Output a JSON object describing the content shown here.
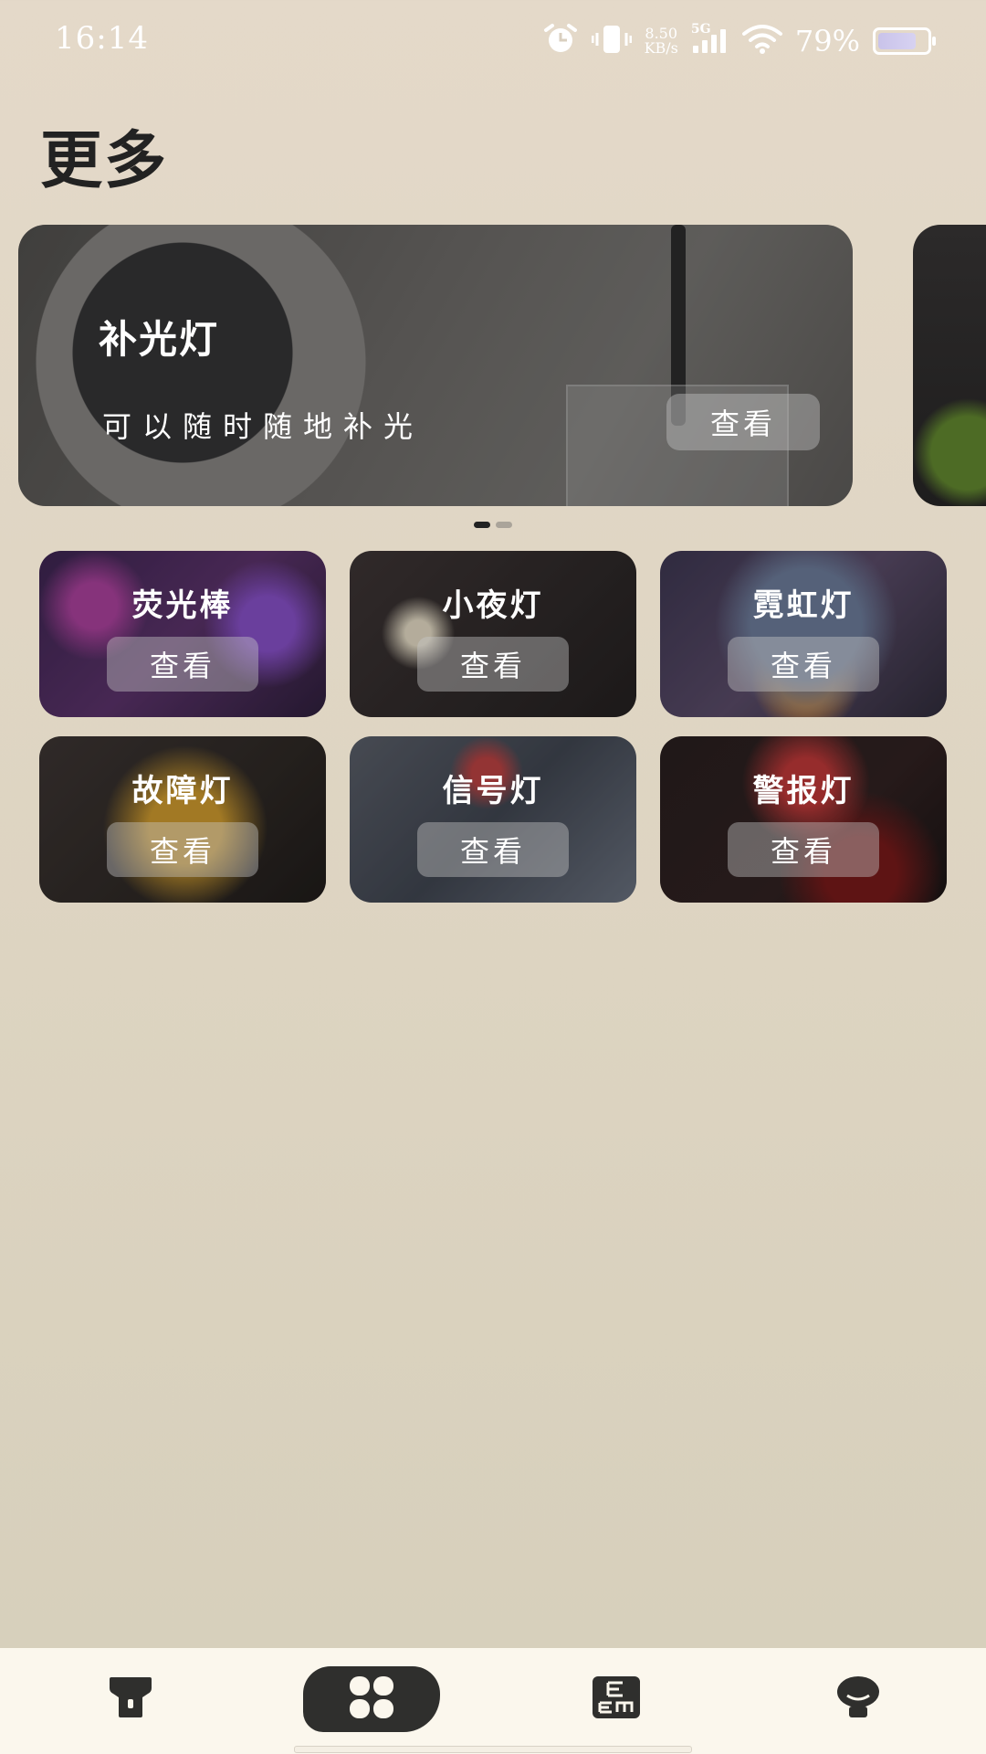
{
  "status_bar": {
    "time": "16:14",
    "net_speed_value": "8.50",
    "net_speed_unit": "KB/s",
    "network_type": "5G",
    "battery_percent": "79%",
    "battery_level": 0.79,
    "icons": [
      "alarm-icon",
      "vibrate-icon",
      "signal-icon",
      "wifi-icon",
      "battery-icon"
    ]
  },
  "page": {
    "title": "更多"
  },
  "banner": {
    "title": "补光灯",
    "subtitle": "可以随时随地补光",
    "button_label": "查看",
    "page_count": 2,
    "active_page": 0
  },
  "cards": [
    {
      "title": "荧光棒",
      "button_label": "查看"
    },
    {
      "title": "小夜灯",
      "button_label": "查看"
    },
    {
      "title": "霓虹灯",
      "button_label": "查看"
    },
    {
      "title": "故障灯",
      "button_label": "查看"
    },
    {
      "title": "信号灯",
      "button_label": "查看"
    },
    {
      "title": "警报灯",
      "button_label": "查看"
    }
  ],
  "bottom_nav": {
    "items": [
      {
        "icon": "flashlight-icon",
        "selected": false
      },
      {
        "icon": "four-leaf-grid-icon",
        "selected": true
      },
      {
        "icon": "eye-chart-icon",
        "selected": false
      },
      {
        "icon": "lamp-icon",
        "selected": false
      }
    ]
  },
  "colors": {
    "accent_dark": "#2f2f2d",
    "background": "#e4d9c9",
    "nav_background": "#fbf7ed"
  }
}
